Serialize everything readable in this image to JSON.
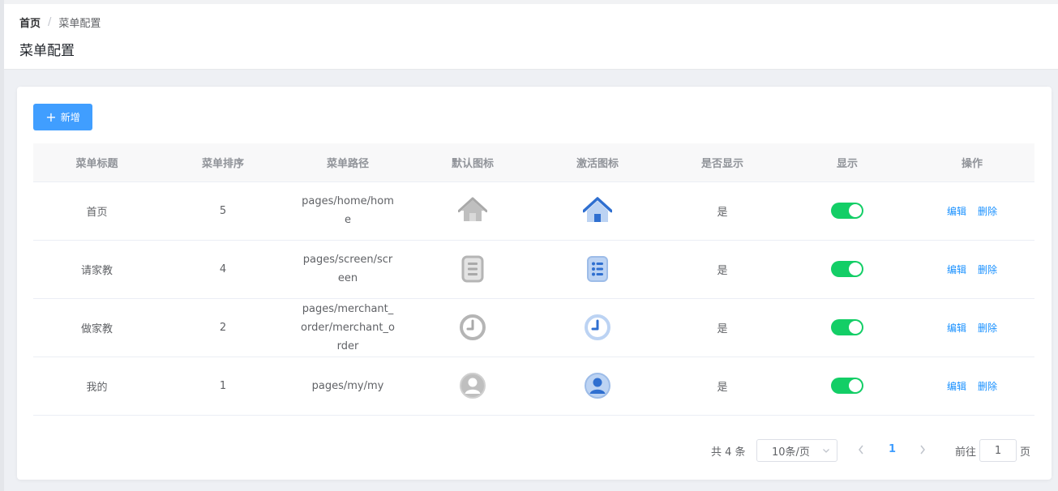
{
  "breadcrumb": {
    "home": "首页",
    "separator": "/",
    "current": "菜单配置"
  },
  "page_title": "菜单配置",
  "toolbar": {
    "add_label": "新增",
    "add_icon": "plus-icon"
  },
  "table": {
    "headers": [
      "菜单标题",
      "菜单排序",
      "菜单路径",
      "默认图标",
      "激活图标",
      "是否显示",
      "显示",
      "操作"
    ],
    "rows": [
      {
        "title": "首页",
        "order": "5",
        "path": "pages/home/home",
        "icon": "home-icon",
        "visible": "是",
        "switch_on": true,
        "edit": "编辑",
        "delete": "删除"
      },
      {
        "title": "请家教",
        "order": "4",
        "path": "pages/screen/screen",
        "icon": "list-icon",
        "visible": "是",
        "switch_on": true,
        "edit": "编辑",
        "delete": "删除"
      },
      {
        "title": "做家教",
        "order": "2",
        "path": "pages/merchant_order/merchant_order",
        "icon": "clock-icon",
        "visible": "是",
        "switch_on": true,
        "edit": "编辑",
        "delete": "删除"
      },
      {
        "title": "我的",
        "order": "1",
        "path": "pages/my/my",
        "icon": "user-icon",
        "visible": "是",
        "switch_on": true,
        "edit": "编辑",
        "delete": "删除"
      }
    ]
  },
  "pagination": {
    "total": "共 4 条",
    "page_size": "10条/页",
    "current_page": "1",
    "goto_label": "前往",
    "goto_value": "1",
    "goto_suffix": "页"
  },
  "colors": {
    "primary": "#409eff",
    "switch_on": "#13ce66",
    "link": "#1890ff",
    "icon_default": "#bfbfbf",
    "icon_active": "#2f6fd0",
    "icon_active_light": "#bcd3f3"
  }
}
